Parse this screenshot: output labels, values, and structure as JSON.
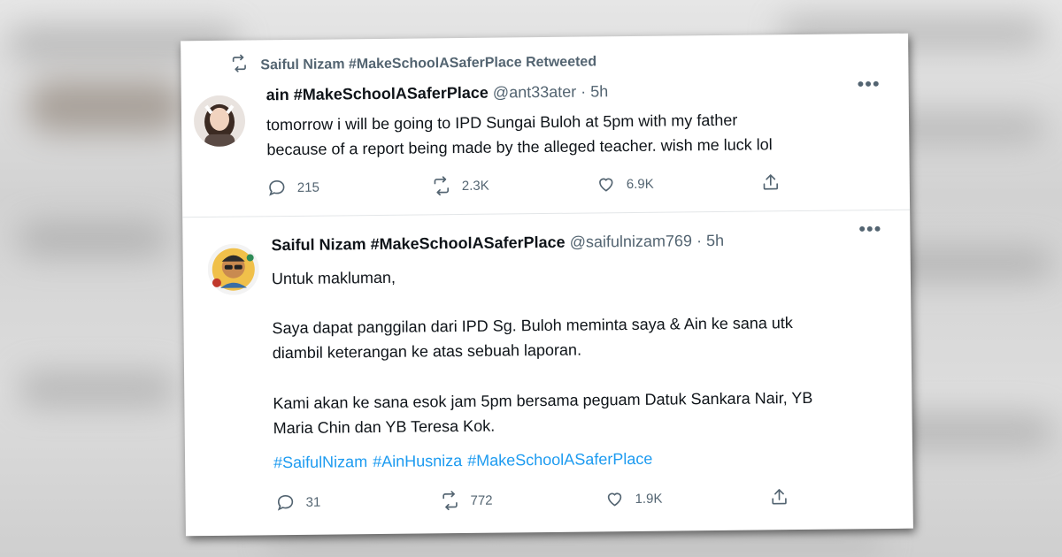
{
  "retweet": {
    "label": "Saiful Nizam #MakeSchoolASaferPlace Retweeted"
  },
  "tweets": [
    {
      "name": "ain #MakeSchoolASaferPlace",
      "handle": "@ant33ater",
      "separator": "·",
      "time": "5h",
      "paragraphs": [
        "tomorrow i will be going to IPD Sungai Buloh at 5pm with my father\nbecause of  a report being made by the alleged teacher. wish me luck lol"
      ],
      "replies": "215",
      "retweets": "2.3K",
      "likes": "6.9K"
    },
    {
      "name": "Saiful Nizam #MakeSchoolASaferPlace",
      "handle": "@saifulnizam769",
      "separator": "·",
      "time": "5h",
      "paragraphs": [
        "Untuk makluman,",
        "Saya dapat panggilan dari IPD Sg. Buloh meminta saya & Ain ke sana utk\ndiambil keterangan ke atas sebuah laporan.",
        "Kami akan ke sana esok jam 5pm bersama peguam Datuk Sankara Nair, YB\nMaria Chin dan YB Teresa Kok."
      ],
      "hashtags": [
        "#SaifulNizam",
        "#AinHusniza",
        "#MakeSchoolASaferPlace"
      ],
      "replies": "31",
      "retweets": "772",
      "likes": "1.9K"
    }
  ],
  "icons": {
    "retweet_indicator": "retweet-icon",
    "more": "more-icon",
    "reply": "reply-icon",
    "retweet": "retweet-icon",
    "like": "heart-icon",
    "share": "share-icon"
  },
  "colors": {
    "text": "#0f1419",
    "secondary": "#536471",
    "link": "#1d9bf0"
  }
}
